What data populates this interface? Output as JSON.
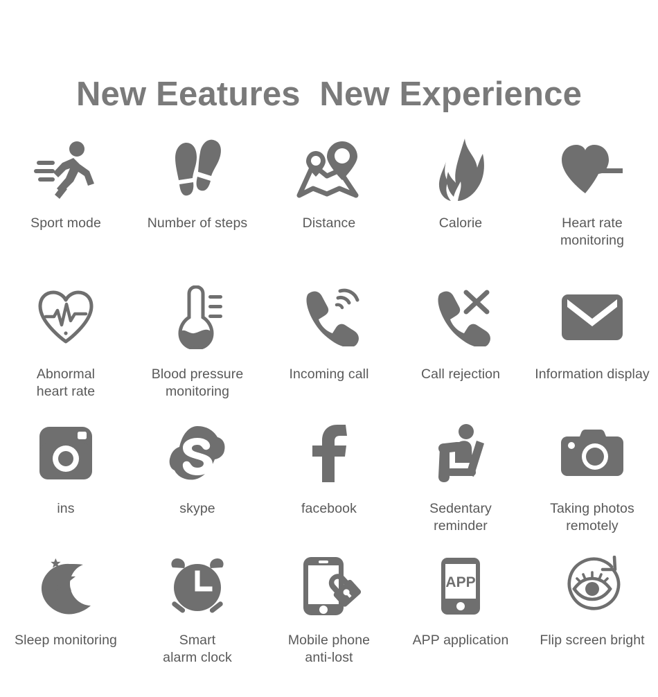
{
  "header": {
    "title": "New Eeatures  New Experience",
    "title_color": "#7a7a7a"
  },
  "theme": {
    "background": "#ffffff",
    "icon_color": "#6f6f6f",
    "label_color": "#595959"
  },
  "features": {
    "columns": 5,
    "rows": [
      {
        "items": [
          {
            "icon": "running-person-icon",
            "label": "Sport mode"
          },
          {
            "icon": "footprints-icon",
            "label": "Number of steps"
          },
          {
            "icon": "map-pins-icon",
            "label": "Distance"
          },
          {
            "icon": "flame-icon",
            "label": "Calorie"
          },
          {
            "icon": "heart-pulse-filled-icon",
            "label": "Heart rate\nmonitoring"
          }
        ]
      },
      {
        "items": [
          {
            "icon": "heart-ecg-outline-icon",
            "label": "Abnormal\nheart rate"
          },
          {
            "icon": "thermometer-icon",
            "label": "Blood pressure\nmonitoring"
          },
          {
            "icon": "phone-ringing-icon",
            "label": "Incoming call"
          },
          {
            "icon": "phone-reject-icon",
            "label": "Call rejection"
          },
          {
            "icon": "envelope-icon",
            "label": "Information display"
          }
        ]
      },
      {
        "items": [
          {
            "icon": "instagram-icon",
            "label": "ins"
          },
          {
            "icon": "skype-icon",
            "label": "skype"
          },
          {
            "icon": "facebook-icon",
            "label": "facebook"
          },
          {
            "icon": "seated-person-icon",
            "label": "Sedentary\nreminder"
          },
          {
            "icon": "camera-icon",
            "label": "Taking photos\nremotely"
          }
        ]
      },
      {
        "items": [
          {
            "icon": "moon-stars-icon",
            "label": "Sleep monitoring"
          },
          {
            "icon": "alarm-clock-icon",
            "label": "Smart\nalarm clock"
          },
          {
            "icon": "phone-lock-icon",
            "label": "Mobile phone\nanti-lost"
          },
          {
            "icon": "app-phone-icon",
            "label": "APP application",
            "glyph_text": "APP"
          },
          {
            "icon": "eye-rotate-icon",
            "label": "Flip screen bright"
          }
        ]
      }
    ]
  }
}
